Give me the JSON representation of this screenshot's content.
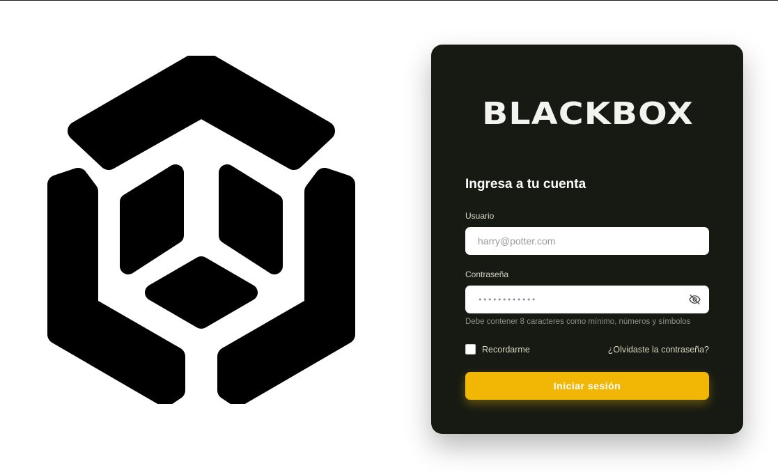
{
  "brand": {
    "name": "BLACKBOX"
  },
  "login": {
    "heading": "Ingresa a tu cuenta",
    "username_label": "Usuario",
    "username_placeholder": "harry@potter.com",
    "password_label": "Contraseña",
    "password_mask": "••••••••••••",
    "password_hint": "Debe contener 8 caracteres como mínimo, números y símbolos",
    "remember_label": "Recordarme",
    "forgot_link": "¿Olvidaste la contraseña?",
    "submit_label": "Iniciar sesión"
  },
  "icons": {
    "logo": "blackbox-cube-logo-icon",
    "password_toggle": "eye-off-icon"
  },
  "colors": {
    "card_bg": "#161a12",
    "accent": "#f2b705",
    "text_light": "#d8d4c4"
  }
}
